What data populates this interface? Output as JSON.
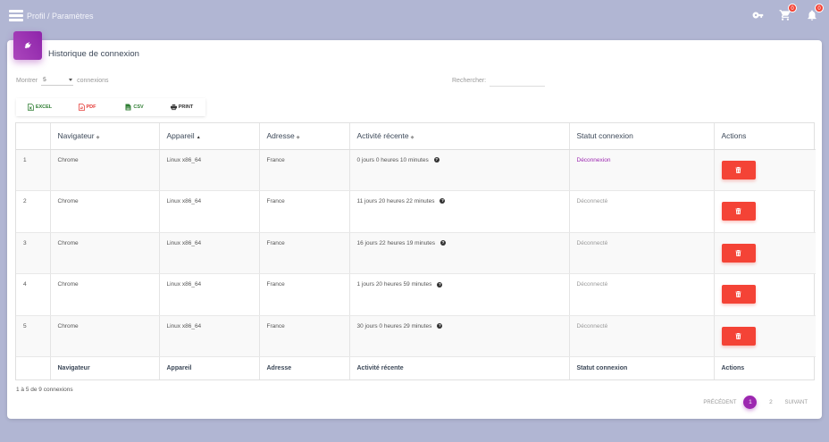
{
  "header": {
    "breadcrumb": "Profil / Paramètres",
    "cart_badge": "0",
    "notif_badge": "0"
  },
  "card": {
    "title": "Historique de connexion",
    "show_prefix": "Montrer",
    "show_value": "5",
    "show_suffix": "connexions",
    "search_label": "Rechercher:",
    "search_value": ""
  },
  "export_buttons": [
    {
      "label": "Excel",
      "color": "#2e7d32"
    },
    {
      "label": "PDF",
      "color": "#e53935"
    },
    {
      "label": "CSV",
      "color": "#2e7d32"
    },
    {
      "label": "Print",
      "color": "#333333"
    }
  ],
  "table": {
    "headers": [
      "",
      "Navigateur",
      "Appareil",
      "Adresse",
      "Activité récente",
      "Statut connexion",
      "Actions"
    ],
    "rows": [
      {
        "num": "1",
        "browser": "Chrome",
        "device": "Linux x86_64",
        "address": "France",
        "activity": "0 jours 0 heures 10 minutes",
        "status": "Déconnexion",
        "status_type": "link"
      },
      {
        "num": "2",
        "browser": "Chrome",
        "device": "Linux x86_64",
        "address": "France",
        "activity": "11 jours 20 heures 22 minutes",
        "status": "Déconnecté",
        "status_type": "off"
      },
      {
        "num": "3",
        "browser": "Chrome",
        "device": "Linux x86_64",
        "address": "France",
        "activity": "16 jours 22 heures 19 minutes",
        "status": "Déconnecté",
        "status_type": "off"
      },
      {
        "num": "4",
        "browser": "Chrome",
        "device": "Linux x86_64",
        "address": "France",
        "activity": "1 jours 20 heures 59 minutes",
        "status": "Déconnecté",
        "status_type": "off"
      },
      {
        "num": "5",
        "browser": "Chrome",
        "device": "Linux x86_64",
        "address": "France",
        "activity": "30 jours 0 heures 29 minutes",
        "status": "Déconnecté",
        "status_type": "off"
      }
    ],
    "footers": [
      "",
      "Navigateur",
      "Appareil",
      "Adresse",
      "Activité récente",
      "Statut connexion",
      "Actions"
    ]
  },
  "info": "1 à 5 de 9 connexions",
  "pagination": {
    "prev": "Précédent",
    "pages": [
      "1",
      "2"
    ],
    "active": "1",
    "next": "Suivant"
  },
  "colors": {
    "accent": "#9c27b0",
    "danger": "#f44336",
    "background": "#b1b6d3"
  }
}
